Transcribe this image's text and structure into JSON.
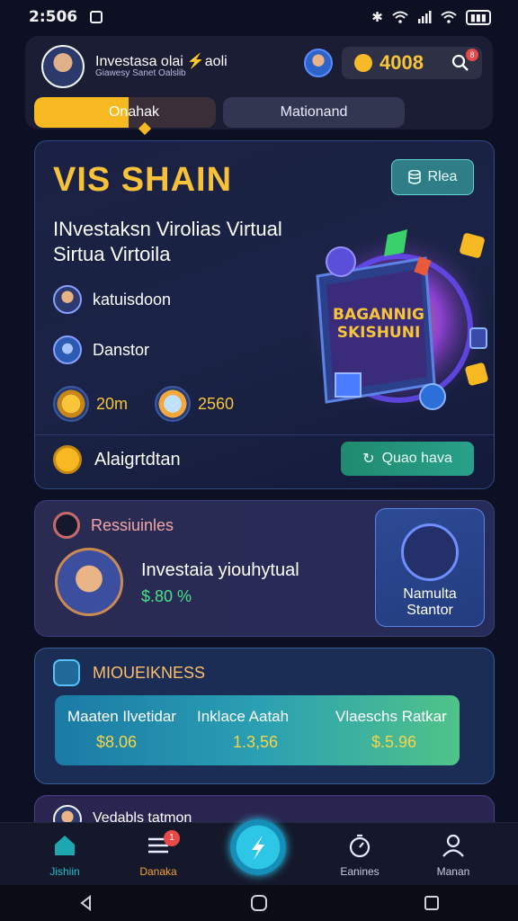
{
  "status_bar": {
    "time": "2:506"
  },
  "header": {
    "profile_name": "Investasa olai",
    "profile_sub": "Giawesy Sanet Oalslib",
    "profile_tag": "aoli",
    "coins": "4008",
    "notif_count": "8",
    "tabs": [
      {
        "label": "Onahak",
        "active": true
      },
      {
        "label": "Mationand",
        "active": false
      }
    ]
  },
  "hero": {
    "title": "VIS SHAIN",
    "button_label": "Rlea",
    "description_line1": "INvestaksn Virolias Virtual",
    "description_line2": "Sirtua Virtoila",
    "row1_label": "katuisdoon",
    "row2_label": "Danstor",
    "stat1": "20m",
    "stat2": "2560",
    "footer_label": "Alaigrtdtan",
    "cta_label": "Quao hava",
    "art_text_line1": "BAGANNIG",
    "art_text_line2": "SKISHUNI"
  },
  "card_results": {
    "heading": "Ressiuinles",
    "title": "Investaia yiouhytual",
    "value": "$.80 %",
    "side_label_line1": "Namulta",
    "side_label_line2": "Stantor"
  },
  "card_metrics": {
    "heading": "MIOUEIKNESS",
    "col1_label": "Maaten Ilvetidar",
    "col2_label": "Inklace Aatah",
    "col3_label": "Vlaeschs Ratkar",
    "col1_value": "$8.06",
    "col2_value": "1.3,56",
    "col3_value": "$.5.96"
  },
  "card_bottom": {
    "title": "Vedabls tatmon"
  },
  "bottom_nav": {
    "items": [
      {
        "label": "Jishiin"
      },
      {
        "label": "Danaka",
        "badge": "1"
      },
      {
        "label": ""
      },
      {
        "label": "Eanines"
      },
      {
        "label": "Manan"
      }
    ]
  },
  "colors": {
    "accent": "#f6b921",
    "teal": "#1fc1c9",
    "green": "#48e28a",
    "background": "#0d0f22"
  }
}
